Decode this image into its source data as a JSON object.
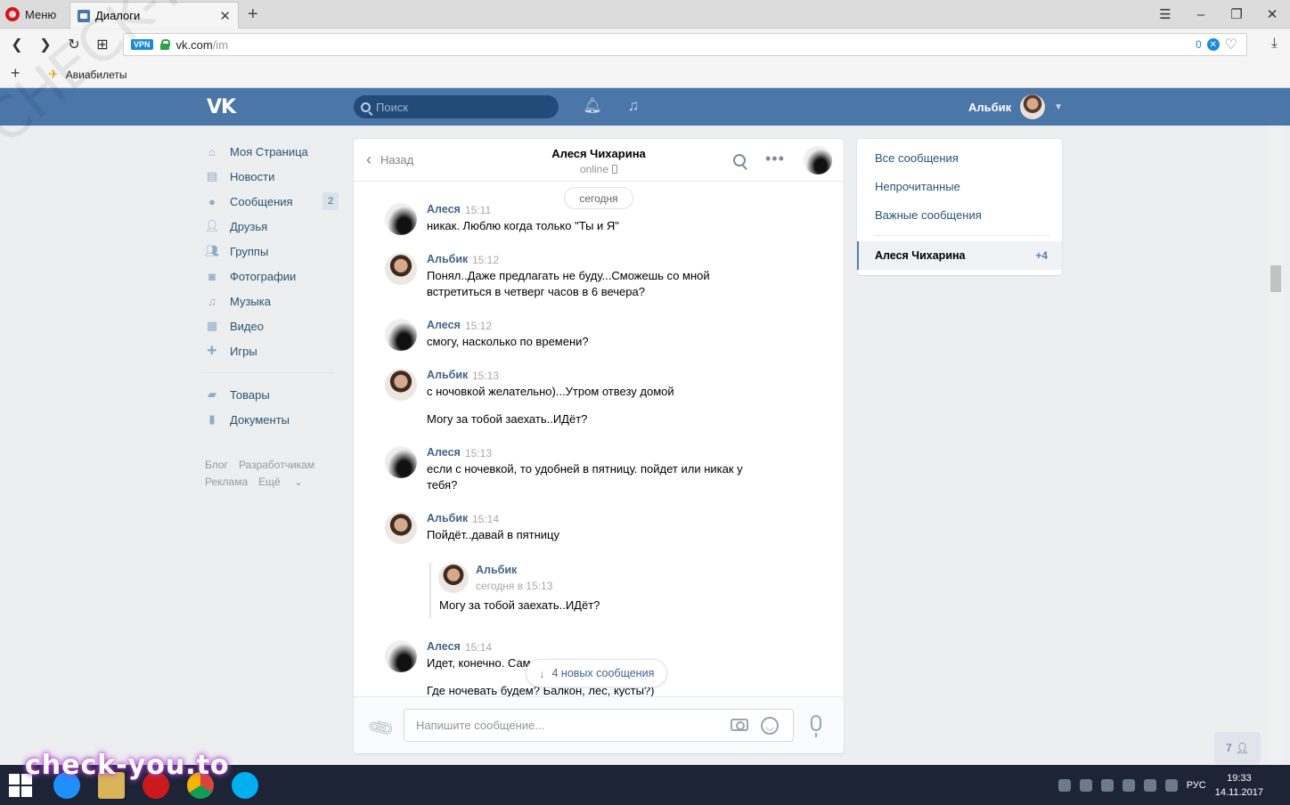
{
  "browser": {
    "menu_label": "Меню",
    "tab_title": "Диалоги",
    "url_host": "vk.com",
    "url_path": "/im",
    "vpn_label": "VPN",
    "adblock_count": "0",
    "bookmark_label": "Авиабилеты"
  },
  "header": {
    "logo": "VK",
    "search_placeholder": "Поиск",
    "user_name": "Альбик"
  },
  "sidebar": {
    "items": [
      {
        "label": "Моя Страница",
        "icon": "home-icon"
      },
      {
        "label": "Новости",
        "icon": "news-icon"
      },
      {
        "label": "Сообщения",
        "icon": "messages-icon",
        "badge": "2"
      },
      {
        "label": "Друзья",
        "icon": "friends-icon"
      },
      {
        "label": "Группы",
        "icon": "groups-icon"
      },
      {
        "label": "Фотографии",
        "icon": "camera-icon"
      },
      {
        "label": "Музыка",
        "icon": "music-icon"
      },
      {
        "label": "Видео",
        "icon": "video-icon"
      },
      {
        "label": "Игры",
        "icon": "gamepad-icon"
      }
    ],
    "secondary": [
      {
        "label": "Товары",
        "icon": "bag-icon"
      },
      {
        "label": "Документы",
        "icon": "document-icon"
      }
    ],
    "footer": {
      "blog": "Блог",
      "developers": "Разработчикам",
      "ads": "Реклама",
      "more": "Ещё"
    }
  },
  "chat": {
    "back_label": "Назад",
    "peer_name": "Алеся Чихарина",
    "peer_status": "online",
    "day_label": "сегодня",
    "messages": [
      {
        "author": "Алеся",
        "time": "15:11",
        "lines": [
          "никак. Люблю когда только \"Ты и Я\""
        ]
      },
      {
        "author": "Альбик",
        "time": "15:12",
        "lines": [
          "Понял..Даже предлагать не буду...Сможешь со мной встретиться в четверг часов в 6 вечера?"
        ]
      },
      {
        "author": "Алеся",
        "time": "15:12",
        "lines": [
          "смогу, насколько по времени?"
        ]
      },
      {
        "author": "Альбик",
        "time": "15:13",
        "lines": [
          "с ночовкой желательно)...Утром отвезу домой",
          "Могу за тобой заехать..ИДёт?"
        ]
      },
      {
        "author": "Алеся",
        "time": "15:13",
        "lines": [
          "если с ночевкой, то удобней в пятницу. пойдет или никак у тебя?"
        ]
      },
      {
        "author": "Альбик",
        "time": "15:14",
        "lines": [
          "Пойдёт..давай в пятницу"
        ]
      },
      {
        "author": "Алеся",
        "time": "15:14",
        "lines": [
          "Идет, конечно. Сам",
          "Где ночевать будем? Балкон, лес, кусты?)"
        ]
      }
    ],
    "forwarded": {
      "author": "Альбик",
      "when": "сегодня в 15:13",
      "text": "Могу за тобой заехать..ИДёт?"
    },
    "new_messages_label": "4 новых сообщения",
    "input_placeholder": "Напишите сообщение..."
  },
  "filters": {
    "all": "Все сообщения",
    "unread": "Непрочитанные",
    "important": "Важные сообщения",
    "peer_name": "Алеся Чихарина",
    "peer_count": "+4"
  },
  "online_count": "7",
  "taskbar": {
    "language": "РУС",
    "time": "19:33",
    "date": "14.11.2017"
  },
  "watermarks": {
    "taskbar": "check-you.to",
    "diagonal": "CHECK-YOU.ME"
  },
  "colors": {
    "vk_header": "#4a76a8",
    "link": "#42648b",
    "accent": "#5181b8"
  }
}
